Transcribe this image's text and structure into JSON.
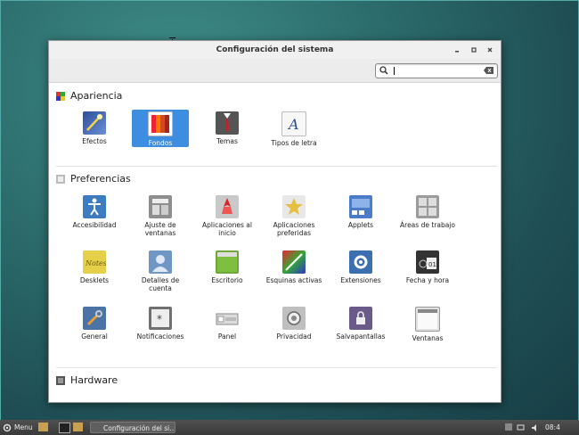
{
  "window": {
    "title": "Configuración del sistema",
    "search_value": ""
  },
  "sections": {
    "apariencia": {
      "title": "Apariencia",
      "items": [
        {
          "label": "Efectos",
          "icon": "efectos-icon",
          "color": "#3a5fa8",
          "selected": false
        },
        {
          "label": "Fondos",
          "icon": "fondos-icon",
          "color": "#d14b1f",
          "selected": true
        },
        {
          "label": "Temas",
          "icon": "temas-icon",
          "color": "#555555",
          "selected": false
        },
        {
          "label": "Tipos de letra",
          "icon": "tipos-de-letra-icon",
          "color": "#f2f2f2",
          "selected": false
        }
      ]
    },
    "preferencias": {
      "title": "Preferencias",
      "items": [
        {
          "label": "Accesibilidad",
          "icon": "accesibilidad-icon",
          "color": "#3d7cc0"
        },
        {
          "label": "Ajuste de ventanas",
          "icon": "ajuste-de-ventanas-icon",
          "color": "#8e8e8e"
        },
        {
          "label": "Aplicaciones al inicio",
          "icon": "aplicaciones-al-inicio-icon",
          "color": "#c9c9c9"
        },
        {
          "label": "Aplicaciones preferidas",
          "icon": "aplicaciones-preferidas-icon",
          "color": "#e5c040"
        },
        {
          "label": "Applets",
          "icon": "applets-icon",
          "color": "#4b7cc8"
        },
        {
          "label": "Áreas de trabajo",
          "icon": "areas-de-trabajo-icon",
          "color": "#9a9a9a"
        },
        {
          "label": "Desklets",
          "icon": "desklets-icon",
          "color": "#e6d04a"
        },
        {
          "label": "Detalles de cuenta",
          "icon": "detalles-de-cuenta-icon",
          "color": "#6f96c4"
        },
        {
          "label": "Escritorio",
          "icon": "escritorio-icon",
          "color": "#6fa83a"
        },
        {
          "label": "Esquinas activas",
          "icon": "esquinas-activas-icon",
          "color": "#3c8a3c"
        },
        {
          "label": "Extensiones",
          "icon": "extensiones-icon",
          "color": "#3b6fb0"
        },
        {
          "label": "Fecha y hora",
          "icon": "fecha-y-hora-icon",
          "color": "#333333"
        },
        {
          "label": "General",
          "icon": "general-icon",
          "color": "#4b73a6"
        },
        {
          "label": "Notificaciones",
          "icon": "notificaciones-icon",
          "color": "#707070"
        },
        {
          "label": "Panel",
          "icon": "panel-icon",
          "color": "#dcdcdc"
        },
        {
          "label": "Privacidad",
          "icon": "privacidad-icon",
          "color": "#bfbfbf"
        },
        {
          "label": "Salvapantallas",
          "icon": "salvapantallas-icon",
          "color": "#6a5a8a"
        },
        {
          "label": "Ventanas",
          "icon": "ventanas-icon",
          "color": "#e0e0e0"
        }
      ]
    },
    "hardware": {
      "title": "Hardware"
    }
  },
  "taskbar": {
    "menu_label": "Menu",
    "task_label": "Configuración del si…",
    "clock": "08:4"
  },
  "colors": {
    "selection": "#3d8ee0",
    "taskbar": "#444444"
  }
}
